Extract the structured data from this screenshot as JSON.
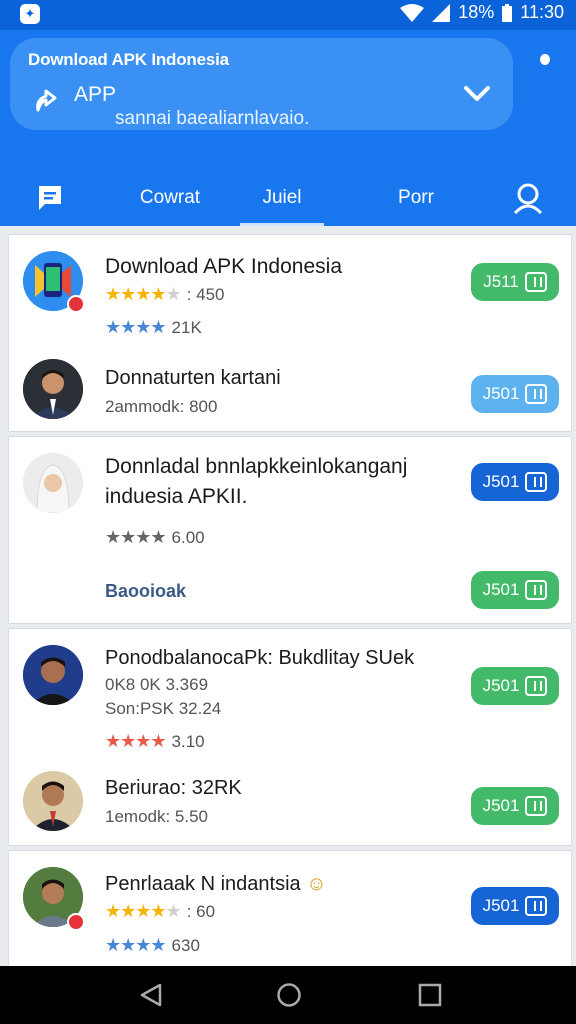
{
  "status_bar": {
    "battery_percent": "18%",
    "time": "11:30"
  },
  "header": {
    "heading": "Download APK Indonesia",
    "title": "APP",
    "subtitle": "sannai baealiarnlavaio."
  },
  "tabs": [
    {
      "label": "Cowrat"
    },
    {
      "label": "Juiel"
    },
    {
      "label": "Porr"
    }
  ],
  "cards": [
    {
      "rows": [
        {
          "name": "Download APK Indonesia",
          "rating_line": "450",
          "stars_line": "21K",
          "button": "J511"
        },
        {
          "name": "Donnaturten kartani",
          "meta": "2ammodk: 800",
          "button": "J501"
        }
      ]
    },
    {
      "name_line1": "Donnladal bnnlapkkeinlokanganj",
      "name_line2": "induesia APKII.",
      "stars_value": "6.00",
      "link": "Baooioak",
      "button_top": "J501",
      "button_bottom": "J501"
    },
    {
      "rows": [
        {
          "name": "PonodbalanocaPk: Bukdlitay SUek",
          "meta1": "0K8 0K 3.369",
          "meta2": "Son:PSK 32.24",
          "stars_value": "3.10",
          "button": "J501"
        },
        {
          "name": "Beriurao: 32RK",
          "meta": "1emodk: 5.50",
          "button": "J501"
        }
      ]
    },
    {
      "rows": [
        {
          "name": "Penrlaaak N indantsia",
          "rating_line": "60",
          "stars_value": "630",
          "button": "J501"
        }
      ]
    }
  ],
  "colors": {
    "primary": "#1877ee",
    "green": "#43b96a",
    "blue": "#1565d6",
    "star_gold": "#f4b400",
    "star_blue": "#4a86d8",
    "star_red": "#e95a4a"
  }
}
